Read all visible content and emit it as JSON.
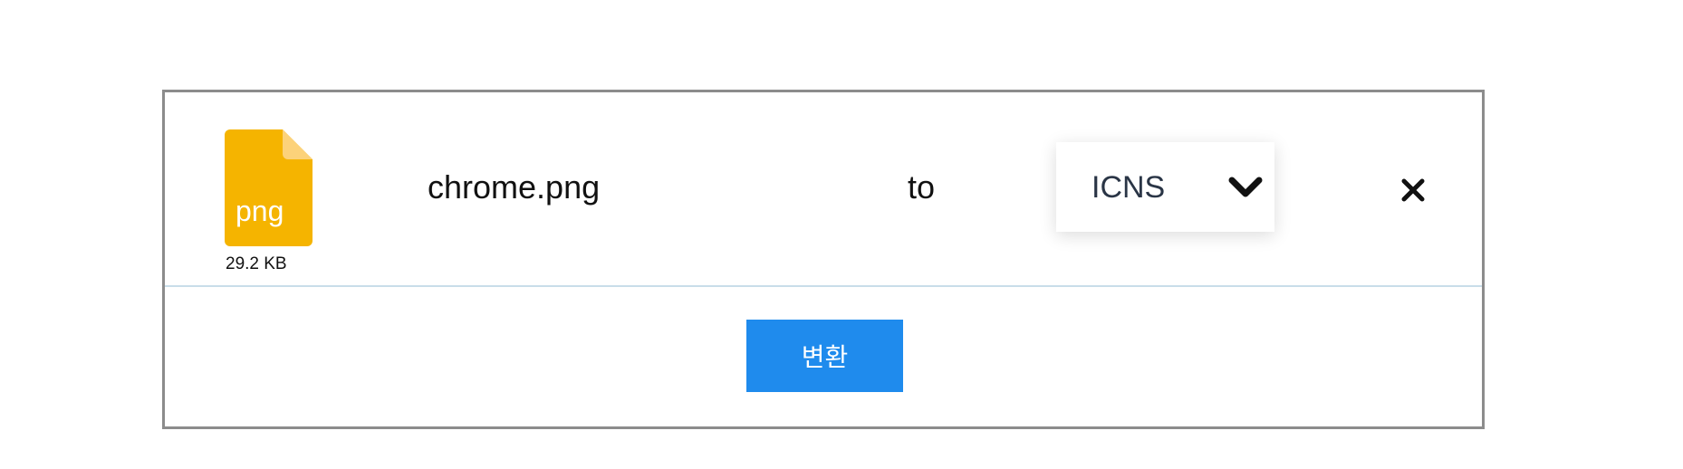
{
  "file": {
    "extension": "png",
    "size": "29.2 KB",
    "name": "chrome.png"
  },
  "conversion": {
    "to_label": "to",
    "selected_format": "ICNS"
  },
  "actions": {
    "convert_label": "변환"
  },
  "colors": {
    "file_icon": "#f5b400",
    "file_icon_fold": "#fcd27a",
    "convert_button": "#1f8bed",
    "panel_border": "#8c8c8c",
    "divider": "#c9dde9"
  },
  "icons": {
    "file": "file-icon",
    "dropdown": "chevron-down-icon",
    "remove": "close-icon"
  }
}
